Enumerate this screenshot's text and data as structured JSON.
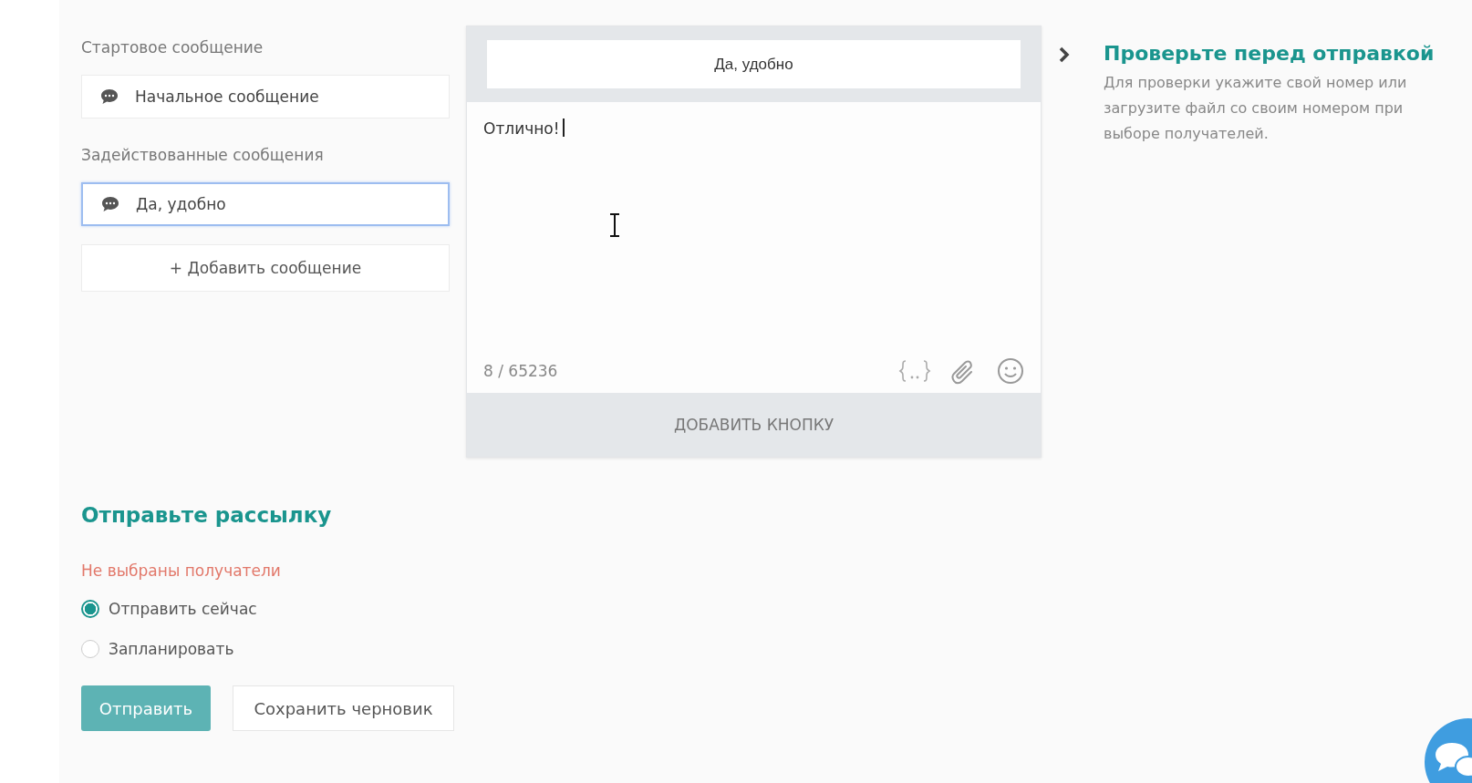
{
  "start_section": {
    "label": "Стартовое сообщение",
    "items": [
      {
        "text": "Начальное сообщение",
        "selected": false
      }
    ]
  },
  "used_section": {
    "label": "Задействованные сообщения",
    "items": [
      {
        "text": "Да, удобно",
        "selected": true
      }
    ]
  },
  "add_message_button": "+ Добавить сообщение",
  "editor": {
    "buttons": [
      "Да, удобно"
    ],
    "message": "Отлично!",
    "counter": "8 / 65236",
    "add_button": "ДОБАВИТЬ КНОПКУ"
  },
  "check_panel": {
    "title": "Проверьте перед отправкой",
    "text": "Для проверки укажите свой номер или загрузите файл со своим номером при выборе получателей."
  },
  "send_section": {
    "title": "Отправьте рассылку",
    "error": "Не выбраны получатели",
    "options": [
      {
        "label": "Отправить сейчас",
        "selected": true
      },
      {
        "label": "Запланировать",
        "selected": false
      }
    ],
    "send_button": "Отправить",
    "draft_button": "Сохранить черновик"
  }
}
